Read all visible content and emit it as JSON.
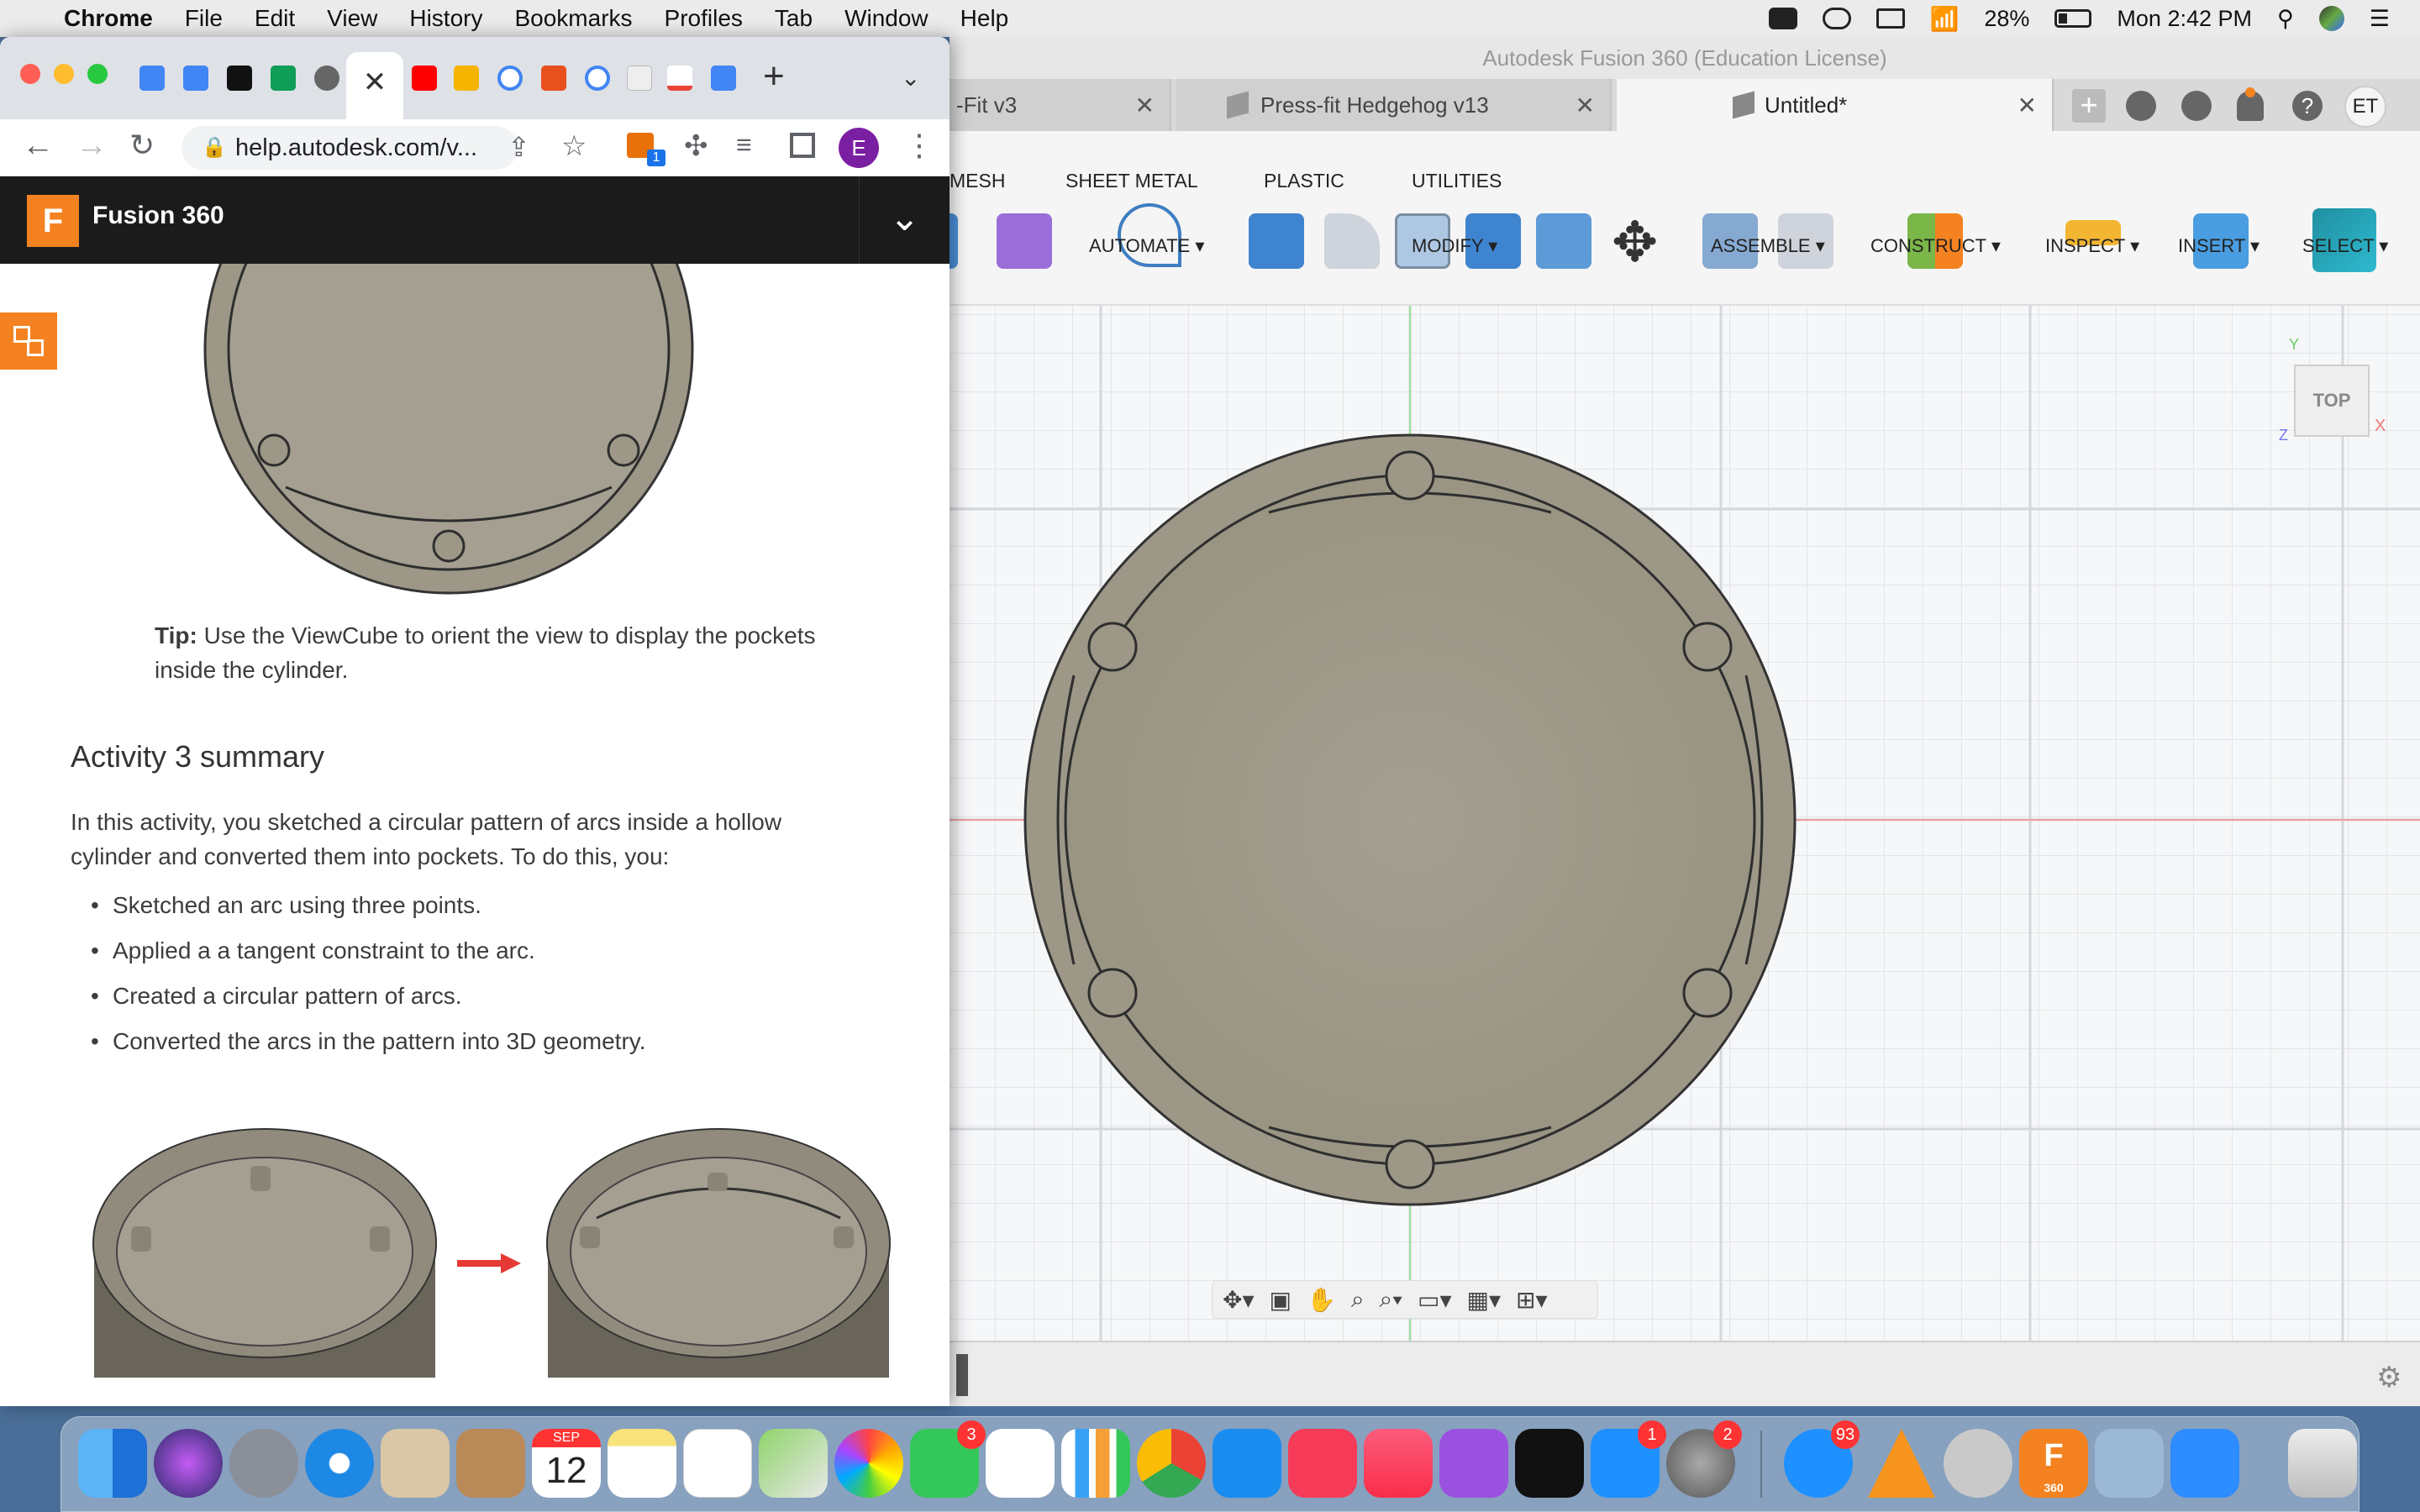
{
  "menubar": {
    "app": "Chrome",
    "items": [
      "File",
      "Edit",
      "View",
      "History",
      "Bookmarks",
      "Profiles",
      "Tab",
      "Window",
      "Help"
    ],
    "battery": "28%",
    "clock": "Mon 2:42 PM"
  },
  "fusion": {
    "window_title": "Autodesk Fusion 360 (Education License)",
    "tabs": [
      {
        "label": "-Fit v3"
      },
      {
        "label": "Press-fit Hedgehog v13"
      },
      {
        "label": "Untitled*"
      }
    ],
    "user_initials": "ET",
    "ribbon_tabs": [
      "MESH",
      "SHEET METAL",
      "PLASTIC",
      "UTILITIES"
    ],
    "groups": [
      "AUTOMATE",
      "MODIFY",
      "ASSEMBLE",
      "CONSTRUCT",
      "INSPECT",
      "INSERT",
      "SELECT"
    ],
    "viewcube_label": "TOP",
    "axis_y": "Y",
    "axis_x": "X",
    "axis_z": "Z"
  },
  "chrome": {
    "url": "help.autodesk.com/v...",
    "profile_initial": "E",
    "ext_badge": "1",
    "site_title": "Fusion 360",
    "tip_label": "Tip:",
    "tip_line1": " Use the ViewCube to orient the view to display the pockets",
    "tip_line2": "inside the cylinder.",
    "summary_heading": "Activity 3 summary",
    "summary_line1": "In this activity, you sketched a circular pattern of arcs inside a hollow",
    "summary_line2": "cylinder and converted them into pockets. To do this, you:",
    "bullets": [
      "Sketched an arc using three points.",
      "Applied a a tangent constraint to the arc.",
      "Created a circular pattern of arcs.",
      "Converted the arcs in the pattern into 3D geometry."
    ]
  },
  "dock": {
    "calendar_month": "SEP",
    "calendar_day": "12",
    "badges": {
      "facetime": "3",
      "appstore": "1",
      "settings": "2",
      "messenger": "93"
    },
    "fusion_label": "360"
  },
  "colors": {
    "accent_orange": "#f58220",
    "dock_badge": "#ff3b30"
  }
}
